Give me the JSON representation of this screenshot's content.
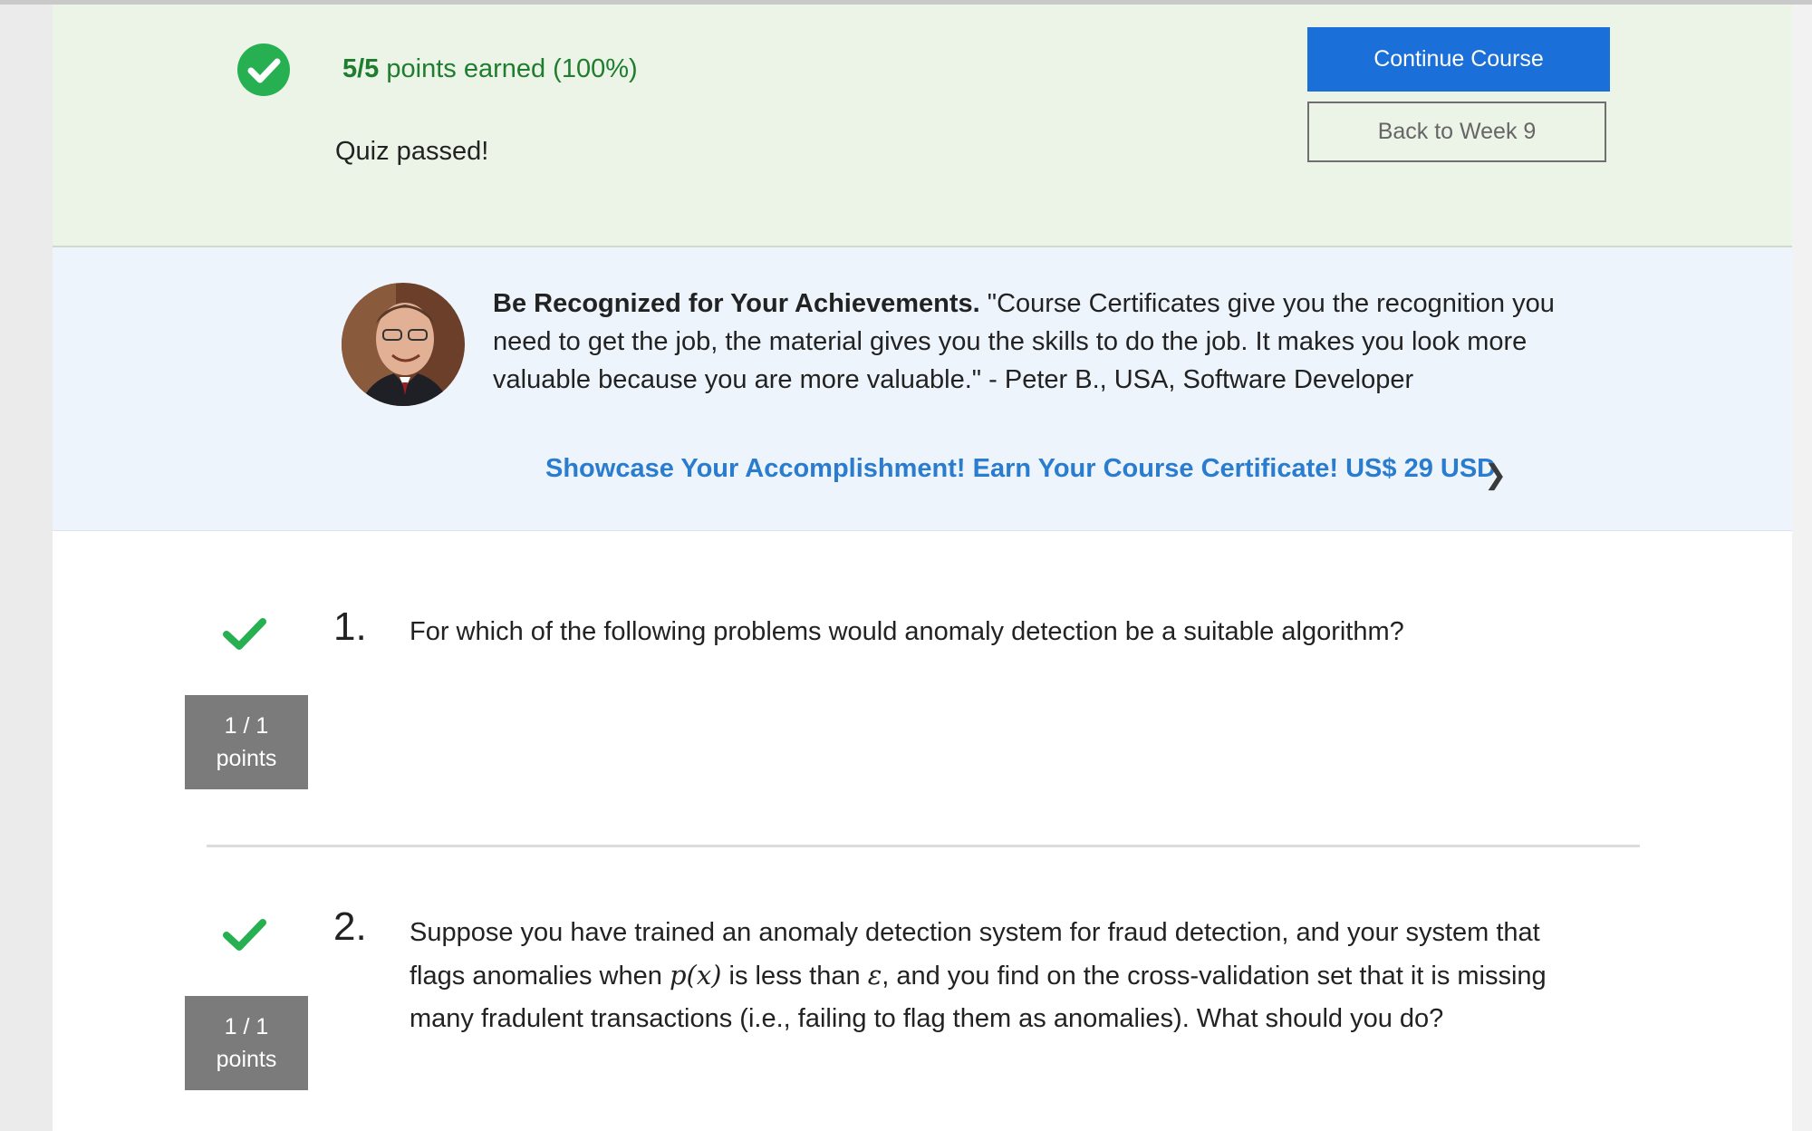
{
  "result": {
    "score_bold": "5/5",
    "score_rest": " points earned (100%)",
    "status": "Quiz passed!",
    "continue_label": "Continue Course",
    "back_label": "Back to Week 9",
    "success_color": "#26b052"
  },
  "promo": {
    "lead": "Be Recognized for Your Achievements.",
    "quote": " \"Course Certificates give you the recognition you need to get the job, the material gives you the skills to do the job. It makes you look more valuable because you are more valuable.\" - Peter B., USA, Software Developer",
    "link": "Showcase Your Accomplishment! Earn Your Course Certificate! US$ 29 USD",
    "link_color": "#2a7ccf"
  },
  "questions": [
    {
      "number": "1.",
      "text": "For which of the following problems would anomaly detection be a suitable algorithm?",
      "score": "1 / 1",
      "score_unit": "points"
    },
    {
      "number": "2.",
      "text_a": "Suppose you have trained an anomaly detection system for fraud detection, and your system that flags anomalies when ",
      "math_p": "p(x)",
      "text_b": " is less than ",
      "math_eps": "ε",
      "text_c": ", and you find on the cross-validation set that it is missing many fradulent transactions (i.e., failing to flag them as anomalies). What should you do?",
      "score": "1 / 1",
      "score_unit": "points"
    }
  ]
}
